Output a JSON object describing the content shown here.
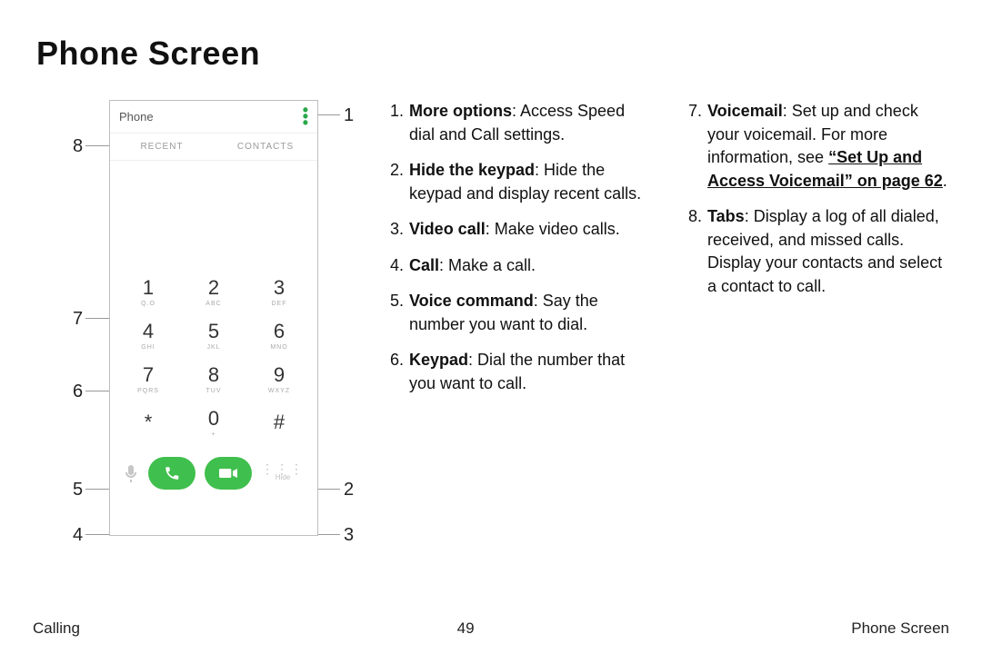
{
  "title": "Phone Screen",
  "phone": {
    "app_title": "Phone",
    "tab_recent": "RECENT",
    "tab_contacts": "CONTACTS",
    "keys": {
      "k1n": "1",
      "k1l": "Q.O",
      "k2n": "2",
      "k2l": "ABC",
      "k3n": "3",
      "k3l": "DEF",
      "k4n": "4",
      "k4l": "GHI",
      "k5n": "5",
      "k5l": "JKL",
      "k6n": "6",
      "k6l": "MNO",
      "k7n": "7",
      "k7l": "PQRS",
      "k8n": "8",
      "k8l": "TUV",
      "k9n": "9",
      "k9l": "WXYZ",
      "kstar": "*",
      "k0n": "0",
      "k0l": "+",
      "khash": "#"
    },
    "hide_label": "Hide"
  },
  "callouts": {
    "n1": "1",
    "n2": "2",
    "n3": "3",
    "n4": "4",
    "n5": "5",
    "n6": "6",
    "n7": "7",
    "n8": "8"
  },
  "left_list": {
    "i1_num": "1.",
    "i1_b": "More options",
    "i1_t": ": Access Speed dial and Call settings.",
    "i2_num": "2.",
    "i2_b": "Hide the keypad",
    "i2_t": ": Hide the keypad and display recent calls.",
    "i3_num": "3.",
    "i3_b": "Video call",
    "i3_t": ": Make video calls.",
    "i4_num": "4.",
    "i4_b": "Call",
    "i4_t": ": Make a call.",
    "i5_num": "5.",
    "i5_b": "Voice command",
    "i5_t": ": Say the number you want to dial.",
    "i6_num": "6.",
    "i6_b": "Keypad",
    "i6_t": ": Dial the number that you want to call."
  },
  "right_list": {
    "i7_num": "7.",
    "i7_b": "Voicemail",
    "i7_t1": ": Set up and check your voicemail. For more information, see ",
    "i7_link": "“Set Up and Access Voicemail” on page 62",
    "i7_t2": ".",
    "i8_num": "8.",
    "i8_b": "Tabs",
    "i8_t": ": Display a log of all dialed, received, and missed calls. Display your contacts and select a contact to call."
  },
  "footer": {
    "left": "Calling",
    "center": "49",
    "right": "Phone Screen"
  }
}
